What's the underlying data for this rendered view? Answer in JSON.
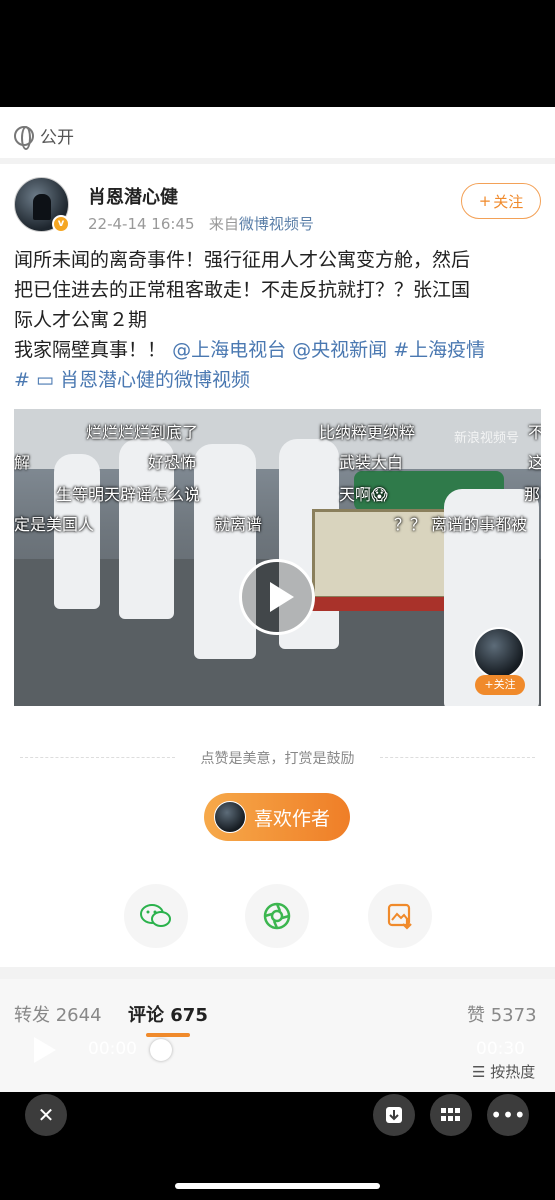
{
  "visibility": {
    "label": "公开"
  },
  "post": {
    "author": "肖恩潜心健",
    "date": "22-4-14 16:45",
    "source_prefix": "来自",
    "source": "微博视频号",
    "follow_label": "关注",
    "text_line1": "闻所未闻的离奇事件！强行征用人才公寓变方舱，然后",
    "text_line2": "把已住进去的正常租客敢走！不走反抗就打？？张江国",
    "text_line3": "际人才公寓２期",
    "text_line4": "我家隔壁真事！！",
    "mention1": "@上海电视台",
    "mention2": "@央视新闻",
    "hashtag": "#上海疫情",
    "video_link": "# ▭ 肖恩潜心健的微博视频"
  },
  "video": {
    "danmu": [
      "烂烂烂烂到底了",
      "比纳粹更纳粹",
      "好恐怖",
      "武装大白",
      "解",
      "生等明天辟谣怎么说",
      "天啊😱",
      "那",
      "定是美国人",
      "就离谱",
      "？？ 离谱的事都被",
      "不",
      "这"
    ],
    "watermark": "新浪视频号",
    "follow_label": "+关注"
  },
  "reward": {
    "tip": "点赞是美意，打赏是鼓励",
    "like_author_label": "喜欢作者"
  },
  "share_icons": [
    "wechat-icon",
    "moments-icon",
    "save-image-icon"
  ],
  "stats": {
    "repost_label": "转发",
    "repost_count": "2644",
    "comment_label": "评论",
    "comment_count": "675",
    "like_label": "赞",
    "like_count": "5373",
    "sort_label": "按热度"
  },
  "player": {
    "current_time": "00:00",
    "duration": "00:30"
  },
  "colors": {
    "accent": "#f08a2b",
    "link": "#4a78b1"
  }
}
